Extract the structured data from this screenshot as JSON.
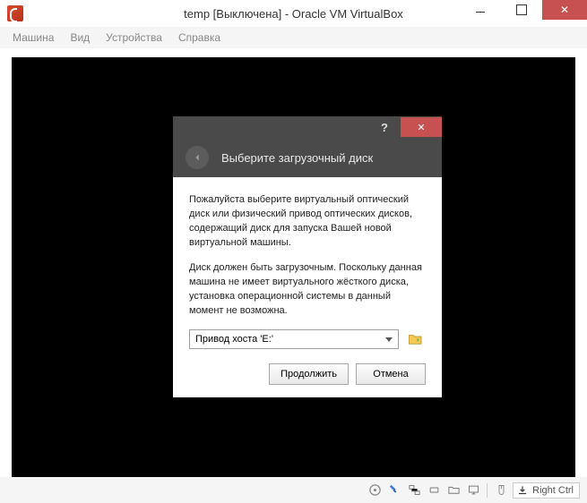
{
  "window": {
    "title": "temp [Выключена] - Oracle VM VirtualBox"
  },
  "menubar": {
    "machine": "Машина",
    "view": "Вид",
    "devices": "Устройства",
    "help": "Справка"
  },
  "dialog": {
    "header_title": "Выберите загрузочный диск",
    "para1": "Пожалуйста выберите виртуальный оптический диск или физический привод оптических дисков, содержащий диск для запуска Вашей новой виртуальной машины.",
    "para2": "Диск должен быть загрузочным. Поскольку данная машина не имеет виртуального жёсткого диска, установка операционной системы в данный момент не возможна.",
    "drive_selected": "Привод хоста 'E:'",
    "continue_label": "Продолжить",
    "cancel_label": "Отмена"
  },
  "statusbar": {
    "host_key": "Right Ctrl"
  }
}
